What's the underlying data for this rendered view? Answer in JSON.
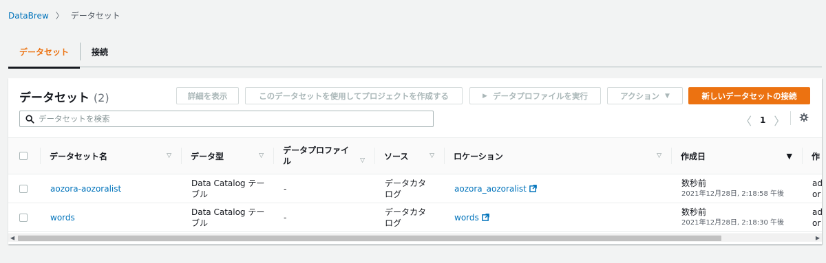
{
  "breadcrumb": {
    "root": "DataBrew",
    "separator": "〉",
    "current": "データセット"
  },
  "tabs": [
    {
      "label": "データセット"
    },
    {
      "label": "接続"
    }
  ],
  "panel": {
    "title": "データセット",
    "count": "(2)",
    "buttons": {
      "details": "詳細を表示",
      "create_project": "このデータセットを使用してプロジェクトを作成する",
      "run_profile": "データプロファイルを実行",
      "actions": "アクション",
      "new_dataset": "新しいデータセットの接続"
    },
    "search": {
      "placeholder": "データセットを検索"
    },
    "pagination": {
      "prev": "〈",
      "page": "1",
      "next": "〉"
    }
  },
  "table": {
    "columns": {
      "name": "データセット名",
      "type": "データ型",
      "profile": "データプロファイル",
      "source": "ソース",
      "location": "ロケーション",
      "created": "作成日",
      "created_by": "作"
    },
    "rows": [
      {
        "name": "aozora-aozoralist",
        "type_line1": "Data Catalog テー",
        "type_line2": "ブル",
        "profile": "-",
        "source_line1": "データカタ",
        "source_line2": "ログ",
        "location": "aozora_aozoralist",
        "created": "数秒前",
        "created_detail": "2021年12月28日, 2:18:58 午後",
        "created_by_line1": "ad",
        "created_by_line2": "or"
      },
      {
        "name": "words",
        "type_line1": "Data Catalog テー",
        "type_line2": "ブル",
        "profile": "-",
        "source_line1": "データカタ",
        "source_line2": "ログ",
        "location": "words",
        "created": "数秒前",
        "created_detail": "2021年12月28日, 2:18:30 午後",
        "created_by_line1": "ad",
        "created_by_line2": "or"
      }
    ]
  },
  "colors": {
    "accent": "#ec7211",
    "link": "#0073bb",
    "text": "#16191f",
    "border": "#aab7b8",
    "muted": "#879596"
  },
  "icons": {
    "search": "search-icon",
    "settings": "gear-icon",
    "external": "external-link-icon",
    "play": "play-icon",
    "sort": "sort-icon"
  }
}
